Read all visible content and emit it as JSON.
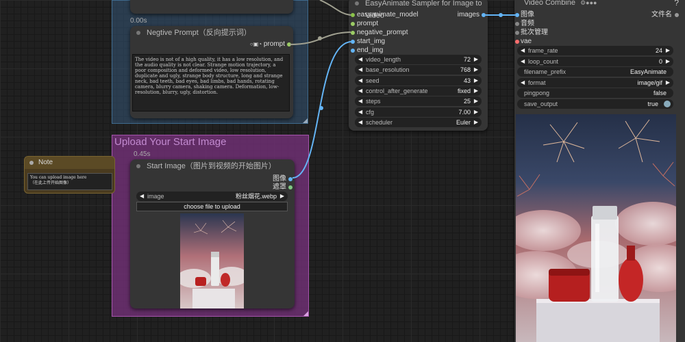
{
  "top_timing": "0.00s",
  "negative_prompt": {
    "title": "Negtive Prompt（反向提示词）",
    "output_label": "prompt",
    "text": "The video is not of a high quality, it has a low resolution, and the audio quality is not clear. Strange motion trajectory, a poor composition and deformed video, low resolution, duplicate and ugly, strange body structure, long and strange neck, bad teeth, bad eyes, bad limbs, bad hands, rotating camera, blurry camera, shaking camera. Deformation, low-resolution, blurry, ugly, distortion."
  },
  "note": {
    "title": "Note",
    "line1": "You can upload image here",
    "line2": "（在此上传开始图像）"
  },
  "upload_group": {
    "title": "Upload Your Start Image",
    "timing": "0.45s"
  },
  "start_image": {
    "title": "Start Image（图片到视频的开始图片）",
    "outputs": [
      "图像",
      "遮罩"
    ],
    "image_label": "image",
    "image_value": "粉丝烟花.webp",
    "upload_button": "choose file to upload"
  },
  "sampler": {
    "title": "EasyAnimate Sampler for Image to Video",
    "inputs": [
      "easyanimate_model",
      "prompt",
      "negative_prompt",
      "start_img",
      "end_img"
    ],
    "output": "images",
    "widgets": [
      {
        "label": "video_length",
        "value": "72"
      },
      {
        "label": "base_resolution",
        "value": "768"
      },
      {
        "label": "seed",
        "value": "43"
      },
      {
        "label": "control_after_generate",
        "value": "fixed"
      },
      {
        "label": "steps",
        "value": "25"
      },
      {
        "label": "cfg",
        "value": "7.00"
      },
      {
        "label": "scheduler",
        "value": "Euler"
      }
    ]
  },
  "video_combine": {
    "title": "Video Combine",
    "help": "?",
    "inputs": [
      "图像",
      "音频",
      "批次管理",
      "vae"
    ],
    "output": "文件名",
    "widgets": [
      {
        "label": "frame_rate",
        "value": "24",
        "arrows": true
      },
      {
        "label": "loop_count",
        "value": "0",
        "arrows": true
      },
      {
        "label": "filename_prefix",
        "value": "EasyAnimate",
        "arrows": false
      },
      {
        "label": "format",
        "value": "image/gif",
        "arrows": true
      },
      {
        "label": "pingpong",
        "value": "false",
        "arrows": false
      },
      {
        "label": "save_output",
        "value": "true",
        "arrows": false
      }
    ]
  },
  "colors": {
    "image_slot": "#64b5f6",
    "mask_slot": "#81c784",
    "vae_slot": "#ff6e6e",
    "prompt_wire": "#a0a090",
    "image_wire": "#64b5f6"
  }
}
